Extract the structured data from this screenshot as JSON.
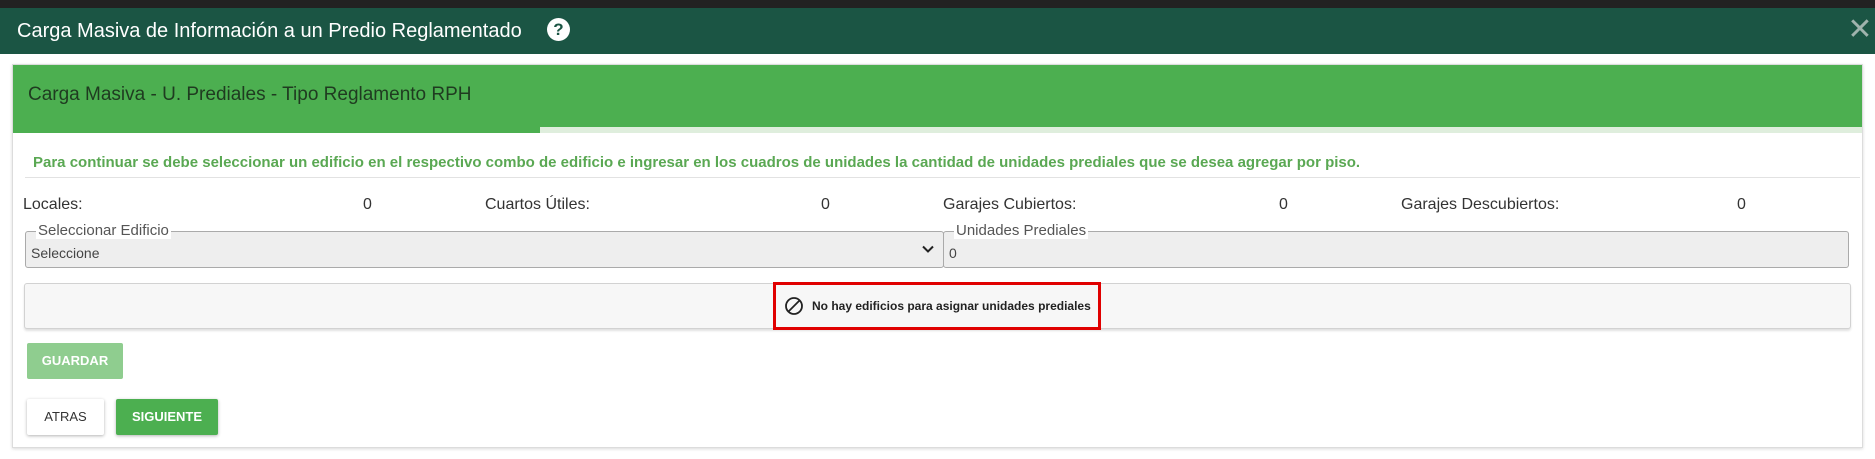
{
  "window": {
    "title": "Carga Masiva de Información a un Predio Reglamentado",
    "help_icon_glyph": "?",
    "close_icon_glyph": "✕"
  },
  "panel": {
    "header_title": "Carga Masiva - U. Prediales - Tipo Reglamento RPH",
    "instruction": "Para continuar se debe seleccionar un edificio en el respectivo combo de edificio e ingresar en los cuadros de unidades la cantidad de unidades prediales que se desea agregar por piso."
  },
  "counters": [
    {
      "label": "Locales:",
      "value": "0"
    },
    {
      "label": "Cuartos Útiles:",
      "value": "0"
    },
    {
      "label": "Garajes Cubiertos:",
      "value": "0"
    },
    {
      "label": "Garajes Descubiertos:",
      "value": "0"
    }
  ],
  "fields": {
    "building_select": {
      "legend": "Seleccionar Edificio",
      "value": "Seleccione"
    },
    "property_units": {
      "legend": "Unidades Prediales",
      "value": "0"
    }
  },
  "message": {
    "icon": "ban-icon",
    "text": "No hay edificios para asignar unidades prediales"
  },
  "buttons": {
    "save": "GUARDAR",
    "back": "ATRAS",
    "next": "SIGUIENTE"
  },
  "colors": {
    "titlebar": "#1b5544",
    "accent_green": "#4caf50",
    "instruction_text": "#5aa853",
    "alert_border": "#e00000"
  }
}
